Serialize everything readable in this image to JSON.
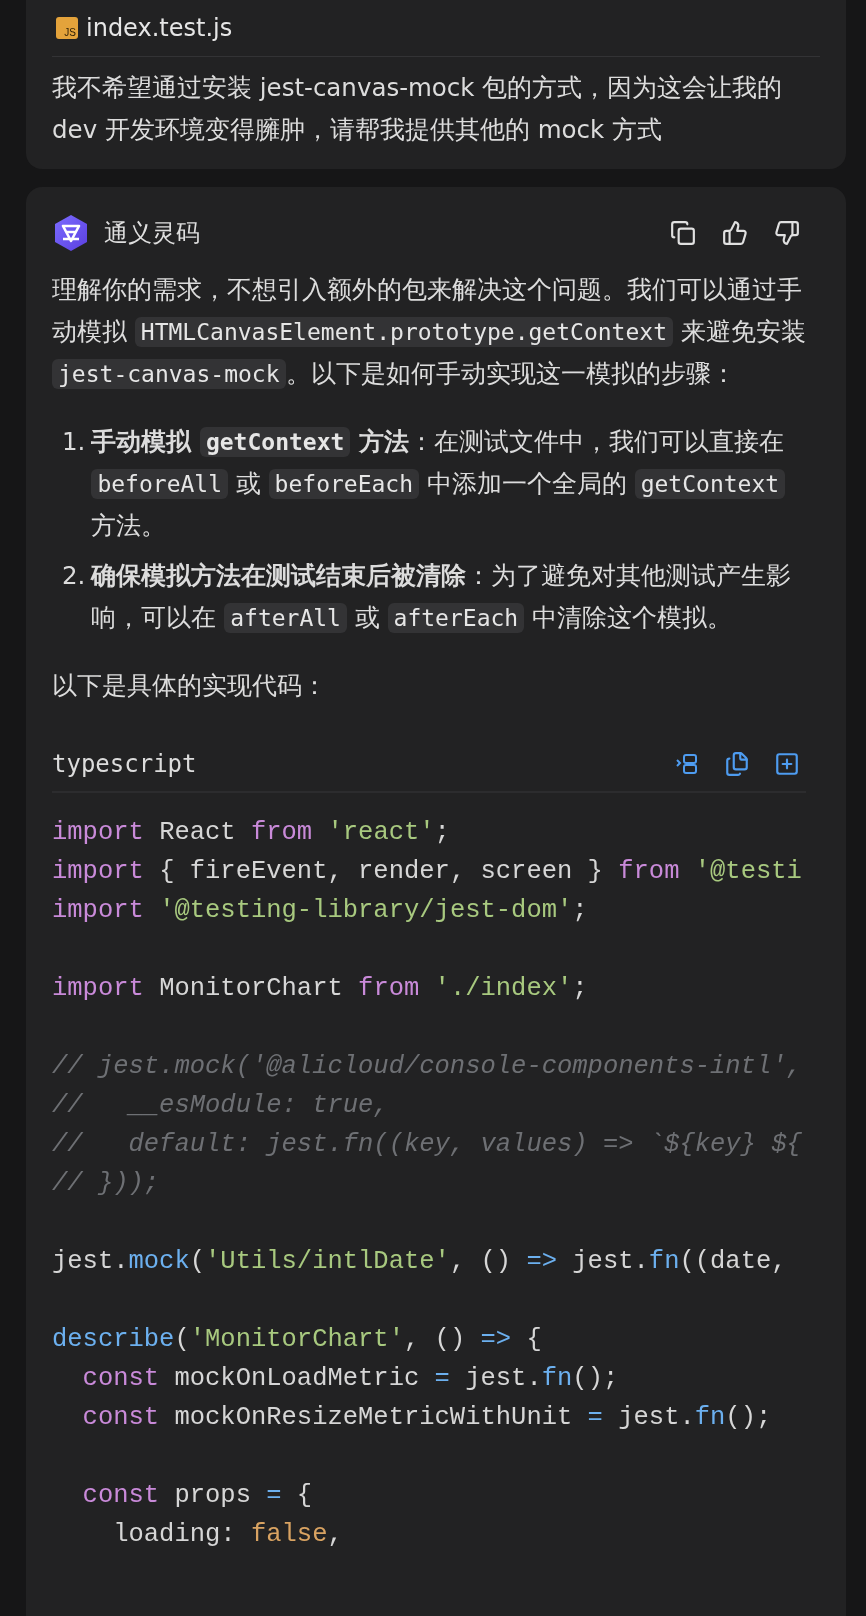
{
  "question_card": {
    "file": {
      "icon_text": "JS",
      "name": "index.test.js"
    },
    "question": "我不希望通过安装 jest-canvas-mock 包的方式，因为这会让我的 dev 开发环境变得臃肿，请帮我提供其他的 mock 方式"
  },
  "answer_card": {
    "assistant": {
      "name": "通义灵码"
    },
    "intro": [
      {
        "kind": "text",
        "text": "理解你的需求，不想引入额外的包来解决这个问题。我们可以通过手动模拟 "
      },
      {
        "kind": "code",
        "text": "HTMLCanvasElement.prototype.getContext"
      },
      {
        "kind": "text",
        "text": " 来避免安装 "
      },
      {
        "kind": "code",
        "text": "jest-canvas-mock"
      },
      {
        "kind": "text",
        "text": "。以下是如何手动实现这一模拟的步骤："
      }
    ],
    "steps": [
      {
        "number": "1.",
        "segments": [
          {
            "kind": "bold",
            "text": "手动模拟 "
          },
          {
            "kind": "bold_code",
            "text": "getContext"
          },
          {
            "kind": "bold",
            "text": " 方法"
          },
          {
            "kind": "text",
            "text": "：在测试文件中，我们可以直接在 "
          },
          {
            "kind": "code",
            "text": "beforeAll"
          },
          {
            "kind": "text",
            "text": " 或 "
          },
          {
            "kind": "code",
            "text": "beforeEach"
          },
          {
            "kind": "text",
            "text": " 中添加一个全局的 "
          },
          {
            "kind": "code",
            "text": "getContext"
          },
          {
            "kind": "text",
            "text": " 方法。"
          }
        ]
      },
      {
        "number": "2.",
        "segments": [
          {
            "kind": "bold",
            "text": "确保模拟方法在测试结束后被清除"
          },
          {
            "kind": "text",
            "text": "：为了避免对其他测试产生影响，可以在 "
          },
          {
            "kind": "code",
            "text": "afterAll"
          },
          {
            "kind": "text",
            "text": " 或 "
          },
          {
            "kind": "code",
            "text": "afterEach"
          },
          {
            "kind": "text",
            "text": " 中清除这个模拟。"
          }
        ]
      }
    ],
    "lead": "以下是具体的实现代码：",
    "code_block": {
      "language": "typescript",
      "blocks": [
        [
          {
            "tokens": [
              {
                "kind": "keyword",
                "text": "import"
              },
              {
                "kind": "plain",
                "text": " React "
              },
              {
                "kind": "keyword",
                "text": "from"
              },
              {
                "kind": "string",
                "text": " 'react'"
              },
              {
                "kind": "plain",
                "text": ";"
              }
            ]
          },
          {
            "tokens": [
              {
                "kind": "keyword",
                "text": "import"
              },
              {
                "kind": "plain",
                "text": " { fireEvent, render, screen } "
              },
              {
                "kind": "keyword",
                "text": "from"
              },
              {
                "kind": "string",
                "text": " '@testi"
              }
            ]
          },
          {
            "tokens": [
              {
                "kind": "keyword",
                "text": "import"
              },
              {
                "kind": "string",
                "text": " '@testing-library/jest-dom'"
              },
              {
                "kind": "plain",
                "text": ";"
              }
            ]
          }
        ],
        [
          {
            "tokens": [
              {
                "kind": "keyword",
                "text": "import"
              },
              {
                "kind": "plain",
                "text": " MonitorChart "
              },
              {
                "kind": "keyword",
                "text": "from"
              },
              {
                "kind": "string",
                "text": " './index'"
              },
              {
                "kind": "plain",
                "text": ";"
              }
            ]
          }
        ],
        [
          {
            "tokens": [
              {
                "kind": "comment",
                "text": "// jest.mock('@alicloud/console-components-intl',"
              }
            ]
          },
          {
            "tokens": [
              {
                "kind": "comment",
                "text": "//   __esModule: true,"
              }
            ]
          },
          {
            "tokens": [
              {
                "kind": "comment",
                "text": "//   default: jest.fn((key, values) => `${key} ${"
              }
            ]
          },
          {
            "tokens": [
              {
                "kind": "comment",
                "text": "// }));"
              }
            ]
          }
        ],
        [
          {
            "tokens": [
              {
                "kind": "plain",
                "text": "jest."
              },
              {
                "kind": "function",
                "text": "mock"
              },
              {
                "kind": "plain",
                "text": "("
              },
              {
                "kind": "string",
                "text": "'Utils/intlDate'"
              },
              {
                "kind": "plain",
                "text": ", () "
              },
              {
                "kind": "operator",
                "text": "=>"
              },
              {
                "kind": "plain",
                "text": " jest."
              },
              {
                "kind": "function",
                "text": "fn"
              },
              {
                "kind": "plain",
                "text": "((date,"
              }
            ]
          }
        ],
        [
          {
            "tokens": [
              {
                "kind": "function",
                "text": "describe"
              },
              {
                "kind": "plain",
                "text": "("
              },
              {
                "kind": "string",
                "text": "'MonitorChart'"
              },
              {
                "kind": "plain",
                "text": ", () "
              },
              {
                "kind": "operator",
                "text": "=>"
              },
              {
                "kind": "plain",
                "text": " {"
              }
            ]
          },
          {
            "tokens": [
              {
                "kind": "keyword",
                "text": "  const"
              },
              {
                "kind": "plain",
                "text": " mockOnLoadMetric "
              },
              {
                "kind": "operator",
                "text": "="
              },
              {
                "kind": "plain",
                "text": " jest."
              },
              {
                "kind": "function",
                "text": "fn"
              },
              {
                "kind": "plain",
                "text": "();"
              }
            ]
          },
          {
            "tokens": [
              {
                "kind": "keyword",
                "text": "  const"
              },
              {
                "kind": "plain",
                "text": " mockOnResizeMetricWithUnit "
              },
              {
                "kind": "operator",
                "text": "="
              },
              {
                "kind": "plain",
                "text": " jest."
              },
              {
                "kind": "function",
                "text": "fn"
              },
              {
                "kind": "plain",
                "text": "();"
              }
            ]
          }
        ],
        [
          {
            "tokens": [
              {
                "kind": "keyword",
                "text": "  const"
              },
              {
                "kind": "plain",
                "text": " props "
              },
              {
                "kind": "operator",
                "text": "="
              },
              {
                "kind": "plain",
                "text": " {"
              }
            ]
          },
          {
            "tokens": [
              {
                "kind": "plain",
                "text": "    loading: "
              },
              {
                "kind": "constant",
                "text": "false"
              },
              {
                "kind": "plain",
                "text": ","
              }
            ]
          }
        ]
      ]
    }
  }
}
